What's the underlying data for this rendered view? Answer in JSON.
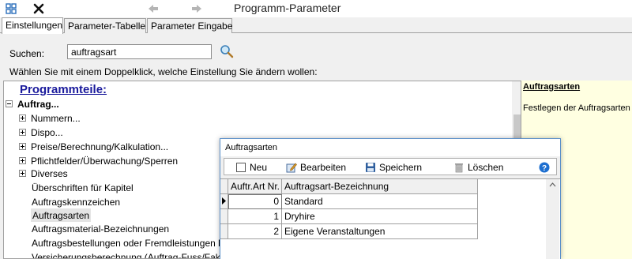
{
  "window": {
    "title": "Programm-Parameter",
    "icons": {
      "grid": "grid-icon",
      "close": "close-x-icon",
      "back": "arrow-left-icon",
      "forward": "arrow-right-icon"
    }
  },
  "tabs": [
    {
      "label": "Einstellungen",
      "active": true
    },
    {
      "label": "Parameter-Tabelle",
      "active": false
    },
    {
      "label": "Parameter Eingabe",
      "active": false
    }
  ],
  "search": {
    "label": "Suchen:",
    "value": "auftragsart",
    "icon": "magnifier-icon"
  },
  "hint": "Wählen Sie mit einem Doppelklick, welche Einstellung Sie ändern wollen:",
  "tree": {
    "heading": "Programmteile:",
    "root": "Auftrag...",
    "groups": [
      "Nummern...",
      "Dispo...",
      "Preise/Berechnung/Kalkulation...",
      "Pflichtfelder/Überwachung/Sperren",
      "Diverses"
    ],
    "leaves": [
      "Überschriften für Kapitel",
      "Auftragskennzeichen",
      "Auftragsarten",
      "Auftragsmaterial-Bezeichnungen",
      "Auftragsbestellungen oder Fremdleistungen be",
      "Versicherungsberechnung (Auftrag-Fuss/Faktu"
    ],
    "selected": "Auftragsarten"
  },
  "description": {
    "title": "Auftragsarten",
    "text": "Festlegen der Auftragsarten"
  },
  "popup": {
    "title": "Auftragsarten",
    "toolbar": {
      "new_label": "Neu",
      "edit_label": "Bearbeiten",
      "save_label": "Speichern",
      "delete_label": "Löschen"
    },
    "columns": [
      "Auftr.Art Nr.",
      "Auftragsart-Bezeichnung"
    ],
    "rows": [
      {
        "nr": "0",
        "name": "Standard"
      },
      {
        "nr": "1",
        "name": "Dryhire"
      },
      {
        "nr": "2",
        "name": "Eigene Veranstaltungen"
      }
    ]
  },
  "colors": {
    "accent_blue": "#1a1a9c",
    "help_blue": "#1e6fd0",
    "desc_bg": "#ffffe1"
  }
}
